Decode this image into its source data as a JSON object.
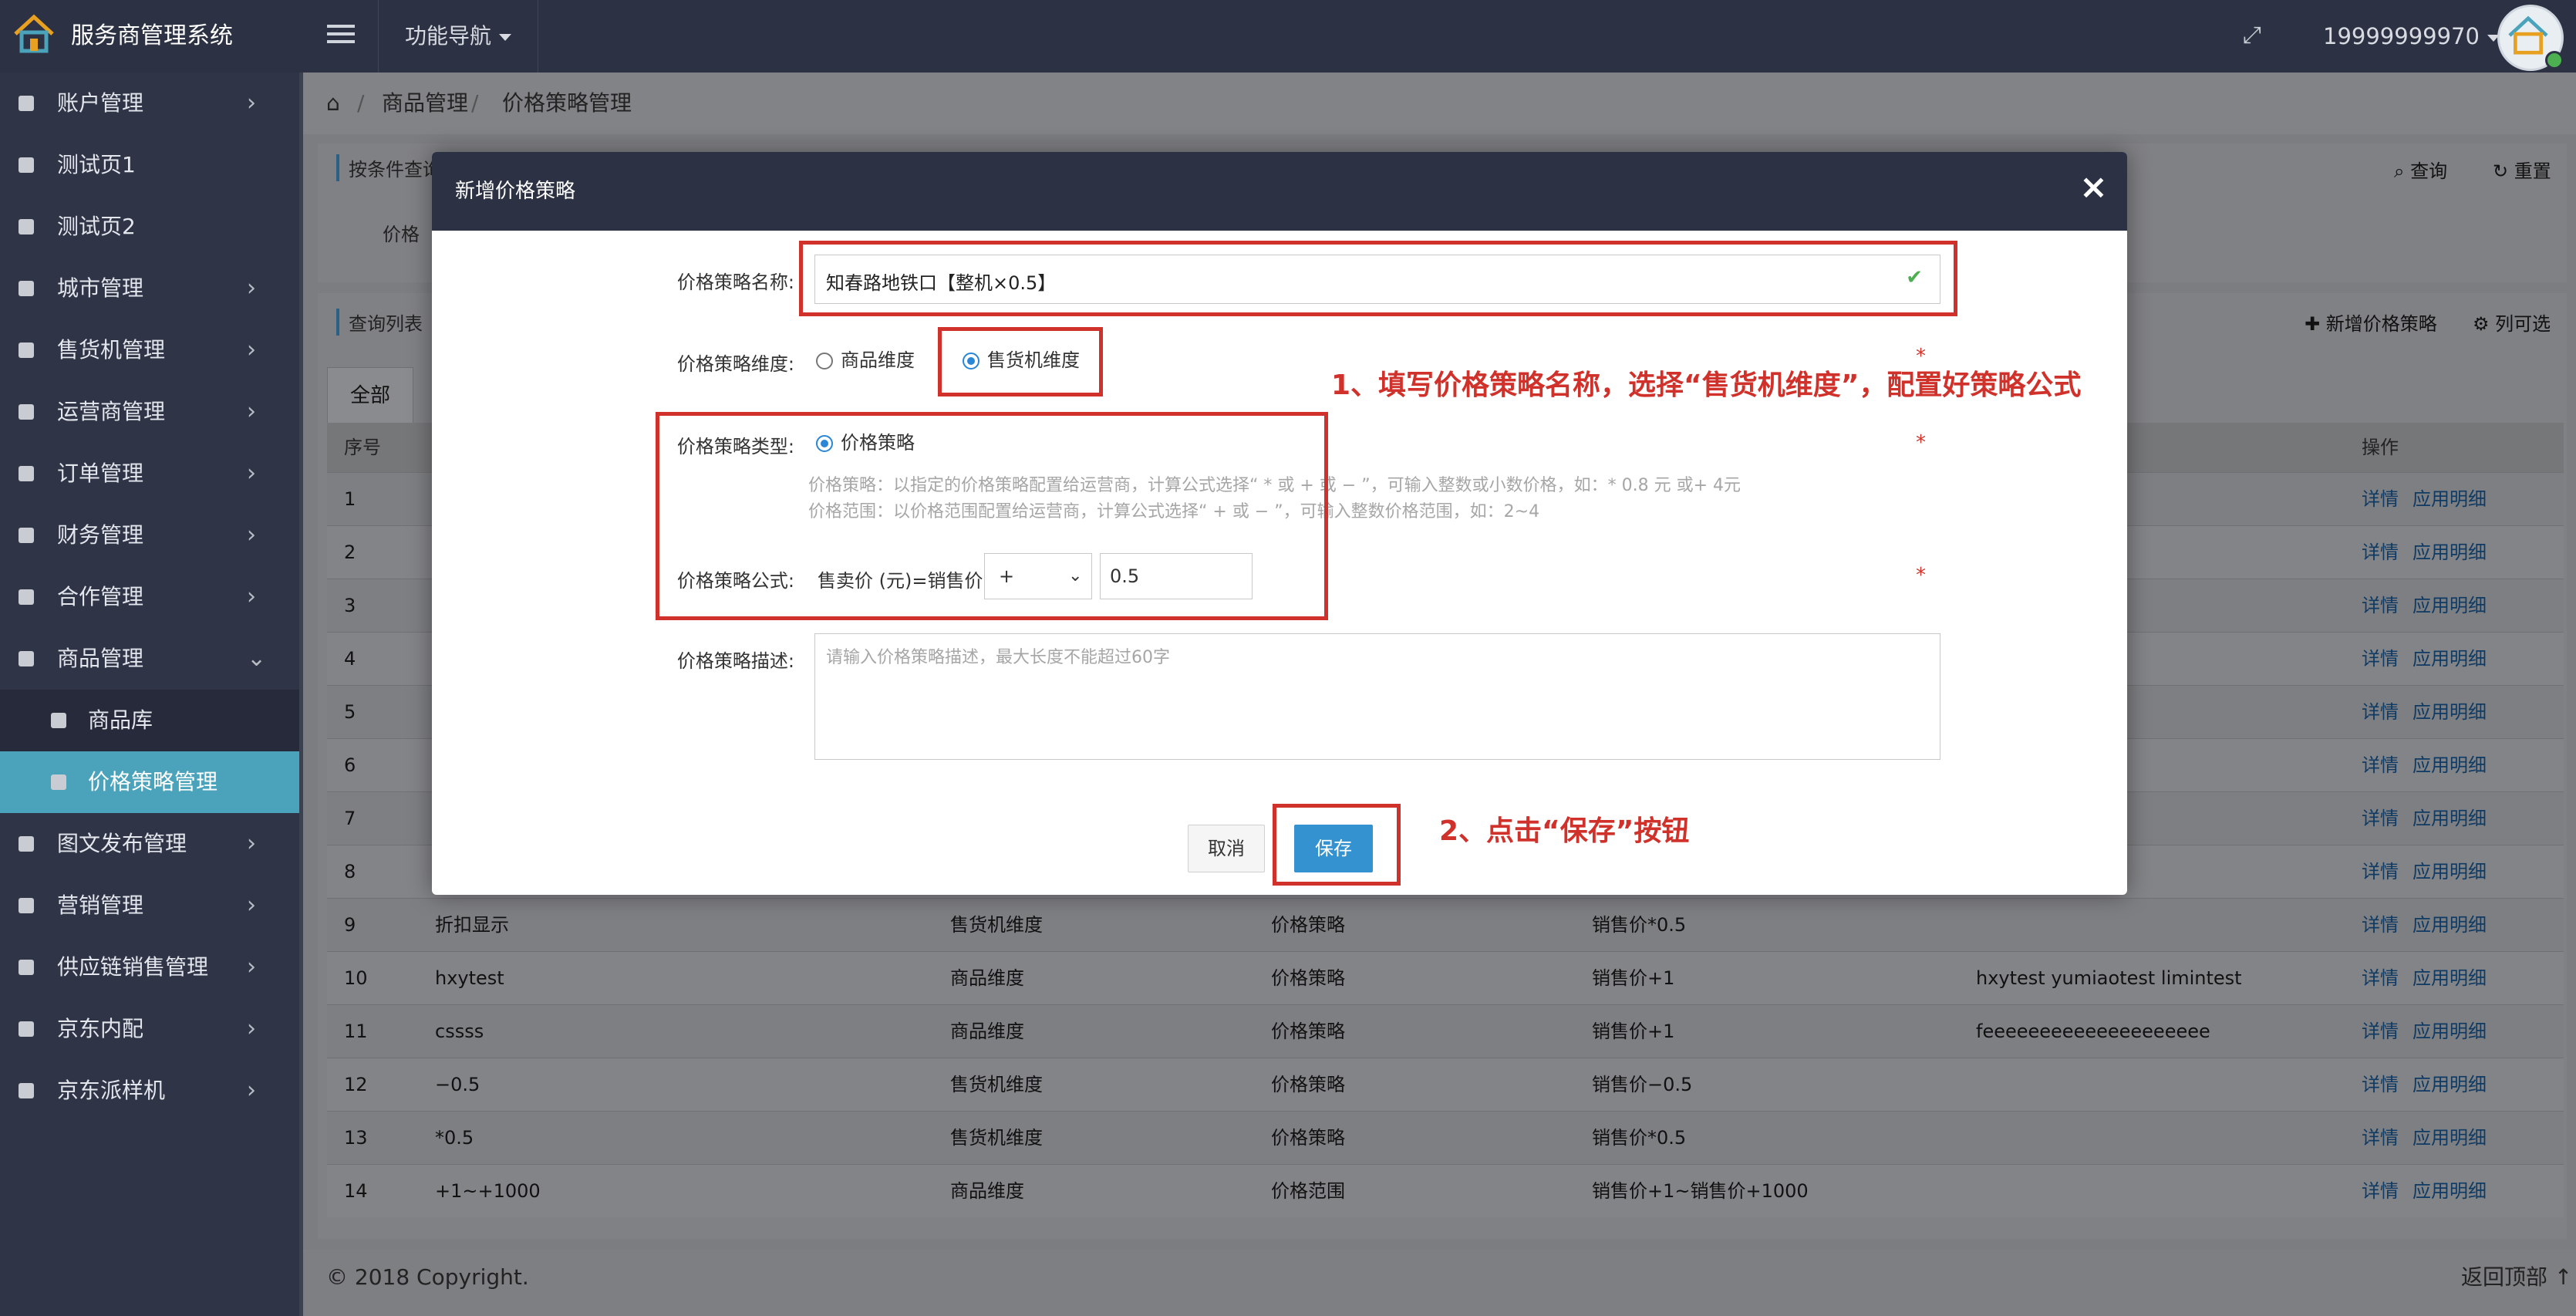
{
  "topbar": {
    "app_title": "服务商管理系统",
    "func_nav": "功能导航",
    "user": "19999999970"
  },
  "sidebar": {
    "items": [
      {
        "label": "账户管理",
        "expand": "›"
      },
      {
        "label": "测试页1",
        "expand": ""
      },
      {
        "label": "测试页2",
        "expand": ""
      },
      {
        "label": "城市管理",
        "expand": "›"
      },
      {
        "label": "售货机管理",
        "expand": "›"
      },
      {
        "label": "运营商管理",
        "expand": "›"
      },
      {
        "label": "订单管理",
        "expand": "›"
      },
      {
        "label": "财务管理",
        "expand": "›"
      },
      {
        "label": "合作管理",
        "expand": "›"
      },
      {
        "label": "商品管理",
        "expand": "⌄"
      },
      {
        "label": "商品库",
        "expand": ""
      },
      {
        "label": "价格策略管理",
        "expand": ""
      },
      {
        "label": "图文发布管理",
        "expand": "›"
      },
      {
        "label": "营销管理",
        "expand": "›"
      },
      {
        "label": "供应链销售管理",
        "expand": "›"
      },
      {
        "label": "京东内配",
        "expand": "›"
      },
      {
        "label": "京东派样机",
        "expand": "›"
      }
    ]
  },
  "breadcrumb": {
    "level1": "商品管理",
    "level2": "价格策略管理"
  },
  "query_panel": {
    "title": "按条件查询",
    "price_label": "价格",
    "query_btn": "查询",
    "reset_btn": "重置"
  },
  "list_panel": {
    "title": "查询列表",
    "add_btn": "新增价格策略",
    "col_btn": "列可选",
    "tab_all": "全部",
    "col_index": "序号",
    "col_actions": "操作",
    "rows": [
      {
        "idx": "1",
        "name": "",
        "dim": "",
        "type": "",
        "formula": "",
        "desc": "",
        "a1": "详情",
        "a2": "应用明细"
      },
      {
        "idx": "2",
        "name": "",
        "dim": "",
        "type": "",
        "formula": "",
        "desc": "",
        "a1": "详情",
        "a2": "应用明细"
      },
      {
        "idx": "3",
        "name": "",
        "dim": "",
        "type": "",
        "formula": "",
        "desc": "",
        "a1": "详情",
        "a2": "应用明细"
      },
      {
        "idx": "4",
        "name": "",
        "dim": "",
        "type": "",
        "formula": "",
        "desc": "",
        "a1": "详情",
        "a2": "应用明细"
      },
      {
        "idx": "5",
        "name": "",
        "dim": "",
        "type": "",
        "formula": "",
        "desc": "",
        "a1": "详情",
        "a2": "应用明细"
      },
      {
        "idx": "6",
        "name": "",
        "dim": "",
        "type": "",
        "formula": "",
        "desc": "",
        "a1": "详情",
        "a2": "应用明细"
      },
      {
        "idx": "7",
        "name": "",
        "dim": "",
        "type": "",
        "formula": "",
        "desc": "",
        "a1": "详情",
        "a2": "应用明细"
      },
      {
        "idx": "8",
        "name": "",
        "dim": "",
        "type": "",
        "formula": "",
        "desc": "",
        "a1": "详情",
        "a2": "应用明细"
      },
      {
        "idx": "9",
        "name": "折扣显示",
        "dim": "售货机维度",
        "type": "价格策略",
        "formula": "销售价*0.5",
        "desc": "",
        "a1": "详情",
        "a2": "应用明细"
      },
      {
        "idx": "10",
        "name": "hxytest",
        "dim": "商品维度",
        "type": "价格策略",
        "formula": "销售价+1",
        "desc": "hxytest yumiaotest limintest",
        "a1": "详情",
        "a2": "应用明细"
      },
      {
        "idx": "11",
        "name": "cssss",
        "dim": "商品维度",
        "type": "价格策略",
        "formula": "销售价+1",
        "desc": "feeeeeeeeeeeeeeeeeeee",
        "a1": "详情",
        "a2": "应用明细"
      },
      {
        "idx": "12",
        "name": "−0.5",
        "dim": "售货机维度",
        "type": "价格策略",
        "formula": "销售价−0.5",
        "desc": "",
        "a1": "详情",
        "a2": "应用明细"
      },
      {
        "idx": "13",
        "name": "*0.5",
        "dim": "售货机维度",
        "type": "价格策略",
        "formula": "销售价*0.5",
        "desc": "",
        "a1": "详情",
        "a2": "应用明细"
      },
      {
        "idx": "14",
        "name": "+1~+1000",
        "dim": "商品维度",
        "type": "价格范围",
        "formula": "销售价+1~销售价+1000",
        "desc": "",
        "a1": "详情",
        "a2": "应用明细"
      }
    ]
  },
  "footer": {
    "copyright": "© 2018 Copyright.",
    "back_top": "返回顶部 ↑"
  },
  "modal": {
    "title": "新增价格策略",
    "name_label": "价格策略名称:",
    "name_value": "知春路地铁口【整机×0.5】",
    "dim_label": "价格策略维度:",
    "dim_opt1": "商品维度",
    "dim_opt2": "售货机维度",
    "type_label": "价格策略类型:",
    "type_opt": "价格策略",
    "hint1": "价格策略：以指定的价格策略配置给运营商，计算公式选择“ * 或 + 或 − ”，可输入整数或小数价格，如：* 0.8 元 或+ 4元",
    "hint2": "价格范围：以价格范围配置给运营商，计算公式选择“ + 或 − ”，可输入整数价格范围，如：2~4",
    "formula_label": "价格策略公式:",
    "formula_text": "售卖价 (元)=销售价",
    "operator": "+",
    "formula_value": "0.5",
    "desc_label": "价格策略描述:",
    "desc_placeholder": "请输入价格策略描述，最大长度不能超过60字",
    "cancel": "取消",
    "save": "保存",
    "required": "*"
  },
  "annotations": {
    "step1": "1、填写价格策略名称，选择“售货机维度”，配置好策略公式",
    "step2": "2、点击“保存”按钮",
    "color": "#d0322b"
  }
}
